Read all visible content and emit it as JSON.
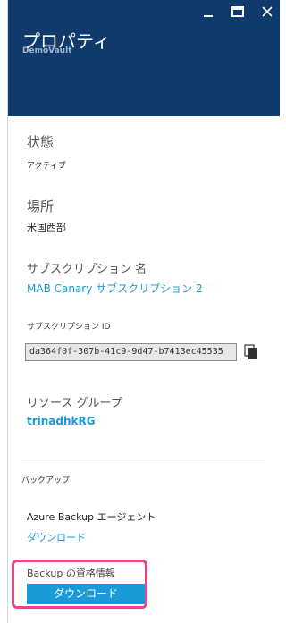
{
  "header": {
    "title": "プロパティ",
    "subtitle": "DemoVault",
    "background_color": "#0f3a6b"
  },
  "window_controls": {
    "minimize_icon": "minimize-icon",
    "maximize_icon": "maximize-icon",
    "close_icon": "close-icon"
  },
  "status": {
    "label": "状態",
    "value": "アクティブ"
  },
  "location": {
    "label": "場所",
    "value": "米国西部"
  },
  "subscription": {
    "label": "サブスクリプション 名",
    "value": "MAB  Canary サブスクリプション 2"
  },
  "subscription_id": {
    "label": "サブスクリプション ID",
    "value": "da364f0f-307b-41c9-9d47-b7413ec45535",
    "copy_icon": "copy-icon"
  },
  "resource_group": {
    "label": "リソース グループ",
    "value": "trinadhkRG"
  },
  "backup": {
    "section_label": "バックアップ",
    "agent_label": "Azure Backup エージェント",
    "agent_download": "ダウンロード",
    "credentials_label": "Backup の資格情報",
    "credentials_download": "ダウンロード"
  },
  "colors": {
    "accent": "#1a9ad6",
    "highlight": "#e34a86"
  }
}
